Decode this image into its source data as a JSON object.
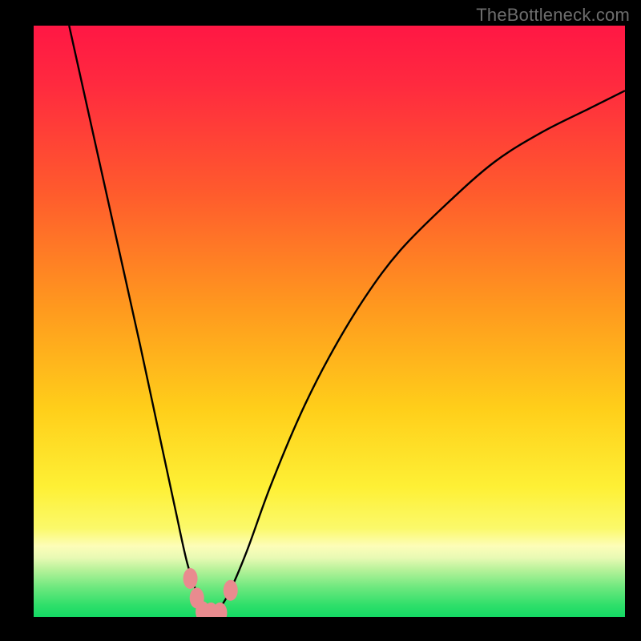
{
  "watermark": "TheBottleneck.com",
  "chart_data": {
    "type": "line",
    "title": "",
    "xlabel": "",
    "ylabel": "",
    "xlim": [
      0,
      100
    ],
    "ylim": [
      0,
      100
    ],
    "series": [
      {
        "name": "bottleneck-curve",
        "x": [
          6,
          10,
          14,
          18,
          21,
          24,
          26,
          28,
          29.5,
          31,
          33,
          36,
          40,
          45,
          50,
          56,
          62,
          70,
          78,
          86,
          94,
          100
        ],
        "values": [
          100,
          82,
          64,
          46,
          32,
          18,
          9,
          3,
          0.5,
          1,
          4,
          11,
          22,
          34,
          44,
          54,
          62,
          70,
          77,
          82,
          86,
          89
        ]
      }
    ],
    "markers": [
      {
        "x": 26.5,
        "y": 6.5
      },
      {
        "x": 27.6,
        "y": 3.2
      },
      {
        "x": 28.6,
        "y": 0.9
      },
      {
        "x": 30.0,
        "y": 0.7
      },
      {
        "x": 31.5,
        "y": 0.7
      },
      {
        "x": 33.3,
        "y": 4.5
      }
    ],
    "gradient_stops": [
      {
        "pct": 0,
        "color": "#ff1744"
      },
      {
        "pct": 10,
        "color": "#ff2a3f"
      },
      {
        "pct": 28,
        "color": "#ff5a2d"
      },
      {
        "pct": 48,
        "color": "#ff9a1e"
      },
      {
        "pct": 65,
        "color": "#ffcf1a"
      },
      {
        "pct": 78,
        "color": "#fef035"
      },
      {
        "pct": 85,
        "color": "#fbf96a"
      },
      {
        "pct": 88,
        "color": "#fdfdb8"
      },
      {
        "pct": 90,
        "color": "#e8fab4"
      },
      {
        "pct": 92,
        "color": "#b7f29a"
      },
      {
        "pct": 95,
        "color": "#6de87e"
      },
      {
        "pct": 98,
        "color": "#2fdf6a"
      },
      {
        "pct": 100,
        "color": "#14d964"
      }
    ],
    "marker_style": {
      "fill": "#e98b8f",
      "rx": 9,
      "ry": 13
    },
    "curve_style": {
      "stroke": "#000000",
      "width": 2.4
    }
  }
}
